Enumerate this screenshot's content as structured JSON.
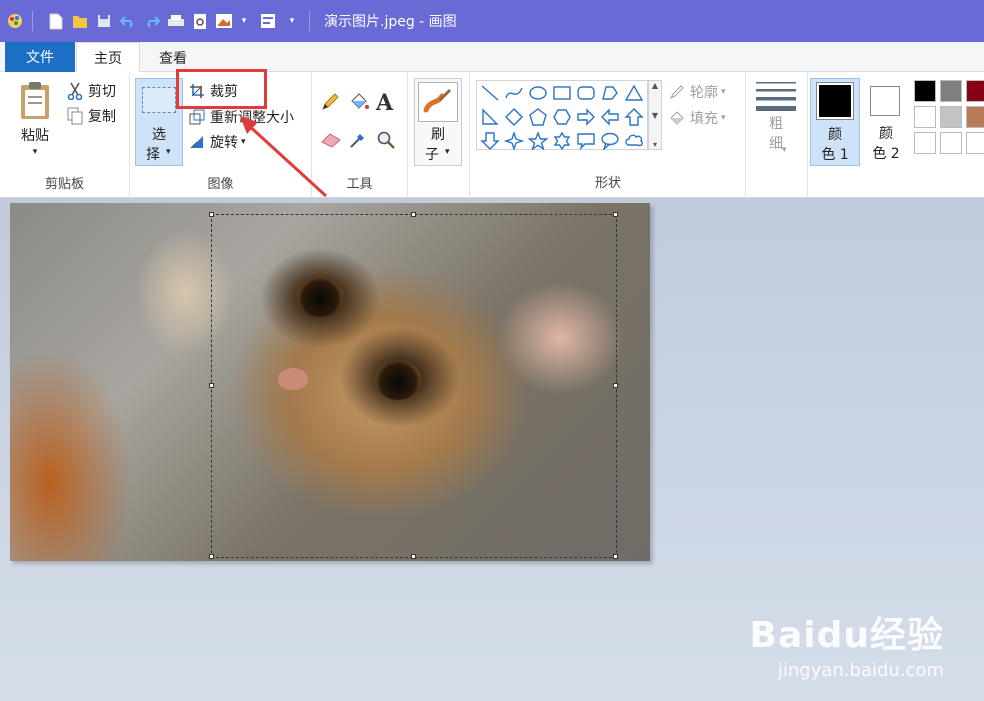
{
  "window": {
    "title": "演示图片.jpeg - 画图"
  },
  "tabs": [
    {
      "label": "文件"
    },
    {
      "label": "主页"
    },
    {
      "label": "查看"
    }
  ],
  "clipboard": {
    "group_label": "剪贴板",
    "paste_label": "粘贴",
    "cut_label": "剪切",
    "copy_label": "复制"
  },
  "image_group": {
    "group_label": "图像",
    "select_line1": "选",
    "select_line2": "择",
    "crop_label": "裁剪",
    "resize_label": "重新调整大小",
    "rotate_label": "旋转"
  },
  "tools": {
    "group_label": "工具"
  },
  "brushes": {
    "line1": "刷",
    "line2": "子"
  },
  "shapes": {
    "group_label": "形状",
    "outline_label": "轮廓",
    "fill_label": "填充",
    "size_line1": "粗",
    "size_line2": "细"
  },
  "colors": {
    "color1_line1": "颜",
    "color1_line2": "色 1",
    "color2_line1": "颜",
    "color2_line2": "色 2",
    "palette": [
      "#000000",
      "#7f7f7f",
      "#880015",
      "#ffffff",
      "#c3c3c3",
      "#b97a57",
      "#ffffff",
      "#ffffff",
      "#ffffff"
    ]
  },
  "watermark": {
    "brand": "Baidu经验",
    "url": "jingyan.baidu.com"
  }
}
